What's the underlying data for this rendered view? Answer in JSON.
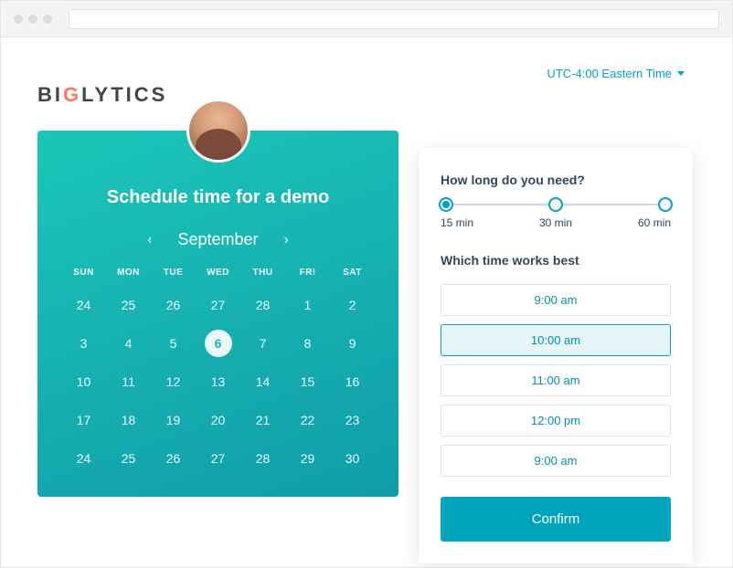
{
  "timezone": {
    "label": "UTC-4:00 Eastern Time"
  },
  "logo": {
    "pre": "BI",
    "accent": "G",
    "post": "LYTICS"
  },
  "calendar": {
    "title": "Schedule time for a demo",
    "month": "September",
    "weekdays": [
      "SUN",
      "MON",
      "TUE",
      "WED",
      "THU",
      "FRI",
      "SAT"
    ],
    "weeks": [
      [
        "24",
        "25",
        "26",
        "27",
        "28",
        "1",
        "2"
      ],
      [
        "3",
        "4",
        "5",
        "6",
        "7",
        "8",
        "9"
      ],
      [
        "10",
        "11",
        "12",
        "13",
        "14",
        "15",
        "16"
      ],
      [
        "17",
        "18",
        "19",
        "20",
        "21",
        "22",
        "23"
      ],
      [
        "24",
        "25",
        "26",
        "27",
        "28",
        "29",
        "30"
      ]
    ],
    "selected_day": "6"
  },
  "picker": {
    "duration_question": "How long do you need?",
    "durations": [
      {
        "label": "15 min",
        "selected": true
      },
      {
        "label": "30 min",
        "selected": false
      },
      {
        "label": "60 min",
        "selected": false
      }
    ],
    "time_question": "Which time works best",
    "slots": [
      {
        "label": "9:00 am",
        "selected": false
      },
      {
        "label": "10:00 am",
        "selected": true
      },
      {
        "label": "11:00 am",
        "selected": false
      },
      {
        "label": "12:00 pm",
        "selected": false
      },
      {
        "label": "9:00 am",
        "selected": false
      }
    ],
    "confirm_label": "Confirm"
  },
  "colors": {
    "brand_teal": "#00a4bd",
    "dark_text": "#33475b",
    "accent_orange": "#ff7a59"
  }
}
